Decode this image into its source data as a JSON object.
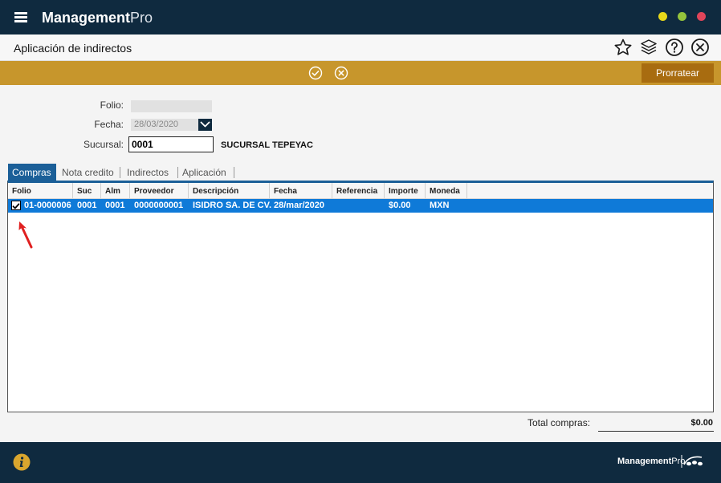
{
  "app": {
    "brand_bold": "Management",
    "brand_light": "Pro"
  },
  "window": {
    "minimize_color": "#e8d81a",
    "maximize_color": "#96c43c",
    "close_color": "#e0455a"
  },
  "header": {
    "title": "Aplicación de indirectos",
    "icons": [
      "star-icon",
      "layers-icon",
      "help-icon",
      "close-icon"
    ]
  },
  "actionbar": {
    "icons": [
      "check-circle-icon",
      "cancel-circle-icon"
    ],
    "prorratear_label": "Prorratear"
  },
  "form": {
    "folio_label": "Folio:",
    "folio_value": "",
    "fecha_label": "Fecha:",
    "fecha_value": "28/03/2020",
    "sucursal_label": "Sucursal:",
    "sucursal_value": "0001",
    "sucursal_name": "SUCURSAL TEPEYAC"
  },
  "tabs": [
    {
      "label": "Compras",
      "active": true
    },
    {
      "label": "Nota credito",
      "active": false
    },
    {
      "label": "Indirectos",
      "active": false
    },
    {
      "label": "Aplicación",
      "active": false
    }
  ],
  "grid": {
    "columns": [
      "Folio",
      "Suc",
      "Alm",
      "Proveedor",
      "Descripción",
      "Fecha",
      "Referencia",
      "Importe",
      "Moneda"
    ],
    "rows": [
      {
        "checked": true,
        "cells": [
          "01-0000006",
          "0001",
          "0001",
          "0000000001",
          "ISIDRO SA. DE CV.",
          "28/mar/2020",
          "",
          "$0.00",
          "MXN"
        ]
      }
    ],
    "selected_color": "#0f7ad8"
  },
  "totals": {
    "label": "Total compras:",
    "value": "$0.00"
  },
  "footer": {
    "brand_bold": "Management",
    "brand_light": "Pro",
    "info_icon": "info-icon"
  },
  "colors": {
    "navy": "#0f2a3f",
    "gold": "#c7962c",
    "tab_blue": "#1b5f98",
    "prorratear": "#a86c10"
  }
}
